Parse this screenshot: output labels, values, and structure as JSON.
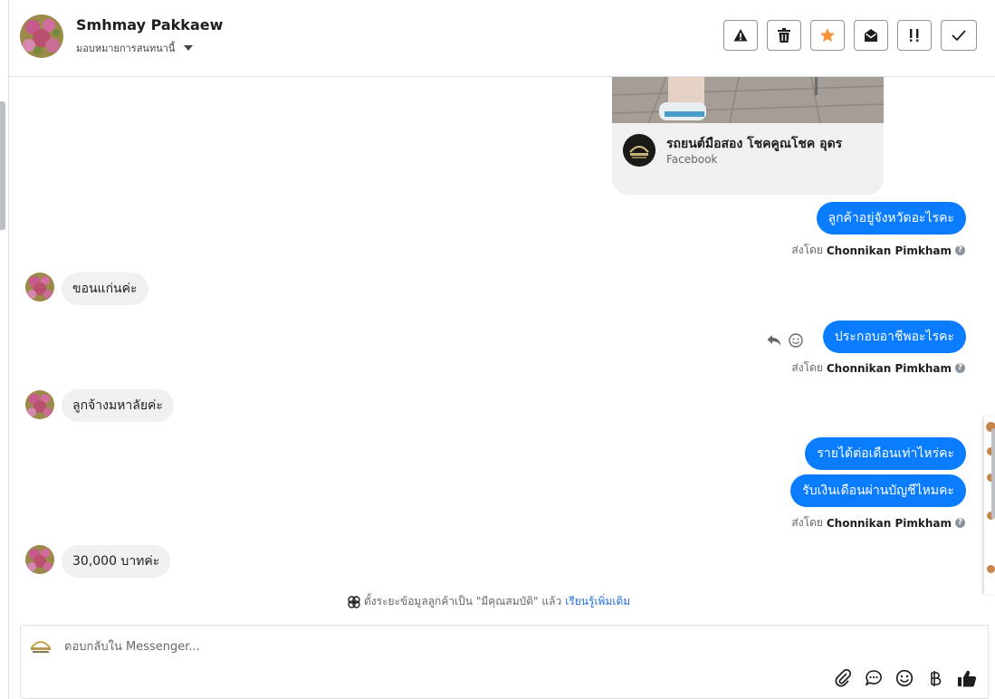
{
  "header": {
    "contact_name": "Smhmay Pakkaew",
    "assign_label": "มอบหมายการสนทนานี้",
    "buttons": [
      {
        "name": "spam",
        "icon": "warning-icon"
      },
      {
        "name": "delete",
        "icon": "trash-icon"
      },
      {
        "name": "star",
        "icon": "star-icon"
      },
      {
        "name": "mark-unread",
        "icon": "envelope-open-icon"
      },
      {
        "name": "follow-up",
        "icon": "exclamation-icon"
      },
      {
        "name": "done",
        "icon": "check-icon"
      }
    ]
  },
  "link_card": {
    "title": "รถยนต์มือสอง โชคคูณโชค อุดร",
    "source": "Facebook"
  },
  "messages": [
    {
      "direction": "out",
      "text": "ลูกค้าอยู่จังหวัดอะไรคะ"
    },
    {
      "direction": "in",
      "text": "ขอนแก่นค่ะ"
    },
    {
      "direction": "out",
      "text": "ประกอบอาชีพอะไรคะ"
    },
    {
      "direction": "in",
      "text": "ลูกจ้างมหาลัยค่ะ"
    },
    {
      "direction": "out",
      "text": "รายได้ต่อเดือนเท่าไหร่คะ"
    },
    {
      "direction": "out",
      "text": "รับเงินเดือนผ่านบัญชีไหมคะ"
    },
    {
      "direction": "in",
      "text": "30,000 บาทค่ะ"
    }
  ],
  "sent_by": {
    "prefix": "ส่งโดย",
    "agent": "Chonnikan Pimkham"
  },
  "system_note": {
    "text": "ตั้งระยะข้อมูลลูกค้าเป็น \"มีคุณสมบัติ\" แล้ว",
    "link": "เรียนรู้เพิ่มเติม"
  },
  "composer": {
    "placeholder": "ตอบกลับใน Messenger...",
    "tools": [
      "paperclip-icon",
      "chat-bubble-icon",
      "emoji-icon",
      "baht-icon",
      "thumbs-up-icon"
    ]
  },
  "colors": {
    "outgoing_bubble": "#0a7cff",
    "incoming_bubble": "#f0f0f0",
    "star_accent": "#f7923a",
    "link": "#216fdb"
  }
}
